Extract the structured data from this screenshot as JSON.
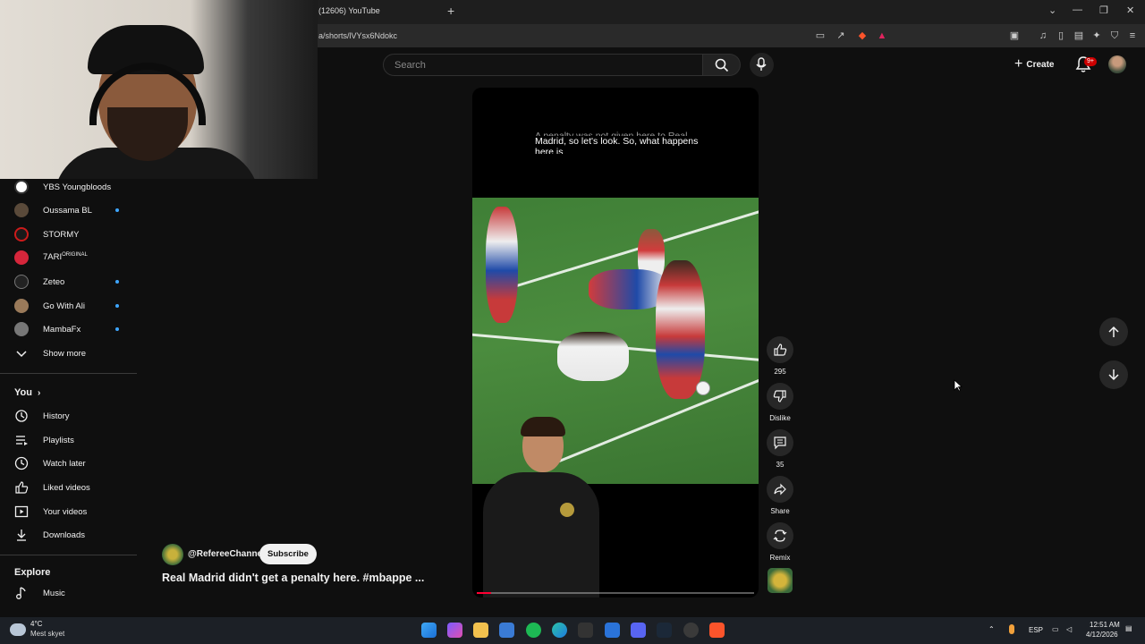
{
  "browser": {
    "tab_title": "(12606) YouTube",
    "url": "a/shorts/lVYsx6Ndokc",
    "window_controls": [
      "⌄",
      "—",
      "❐",
      "✕"
    ]
  },
  "header": {
    "search_placeholder": "Search",
    "create_label": "Create",
    "notifications_badge": "9+"
  },
  "sidebar": {
    "subscriptions": [
      {
        "label": "YBS Youngbloods",
        "new": false,
        "color": "#ffffff"
      },
      {
        "label": "Oussama BL",
        "new": true,
        "color": "#5a4a3a"
      },
      {
        "label": "STORMY",
        "new": false,
        "color": "#cc1b1b"
      },
      {
        "label": "7ARI",
        "suffix": "ORIGINAL",
        "new": false,
        "color": "#d6263b"
      },
      {
        "label": "Zeteo",
        "new": true,
        "color": "#444444"
      },
      {
        "label": "Go With Ali",
        "new": true,
        "color": "#9a7a5a"
      },
      {
        "label": "MambaFx",
        "new": true,
        "color": "#777777"
      }
    ],
    "show_more": "Show more",
    "you_heading": "You",
    "you_items": [
      "History",
      "Playlists",
      "Watch later",
      "Liked videos",
      "Your videos",
      "Downloads"
    ],
    "explore_heading": "Explore",
    "explore_items": [
      "Music"
    ]
  },
  "short": {
    "caption_partial": "A penalty was not given here to Real",
    "caption_line2": "Madrid, so let's look. So, what happens",
    "caption_line3": "here is",
    "channel": "@RefereeChannel",
    "subscribe": "Subscribe",
    "title": "Real Madrid didn't get a penalty here. #mbappe ...",
    "progress": 0.05
  },
  "actions": {
    "likes": "295",
    "dislike": "Dislike",
    "comments": "35",
    "share": "Share",
    "remix": "Remix"
  },
  "taskbar": {
    "temperature": "4°C",
    "weather": "Mest skyet",
    "language": "ESP",
    "time": "12:51 AM",
    "date": "4/12/2026"
  }
}
